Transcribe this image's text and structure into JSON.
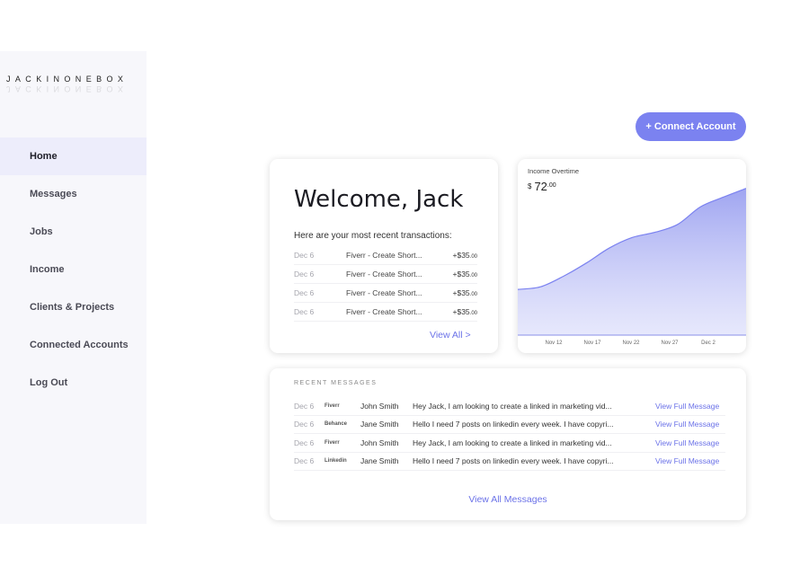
{
  "brand": "JACKINONEBOX",
  "nav": [
    {
      "label": "Home",
      "active": true
    },
    {
      "label": "Messages",
      "active": false
    },
    {
      "label": "Jobs",
      "active": false
    },
    {
      "label": "Income",
      "active": false
    },
    {
      "label": "Clients & Projects",
      "active": false
    },
    {
      "label": "Connected Accounts",
      "active": false
    },
    {
      "label": "Log Out",
      "active": false
    }
  ],
  "connect_button": "+ Connect Account",
  "welcome": {
    "title": "Welcome, Jack",
    "subtitle": "Here are your most recent transactions:",
    "transactions": [
      {
        "date": "Dec 6",
        "desc": "Fiverr - Create Short...",
        "amount": "+$35",
        "cents": ".00"
      },
      {
        "date": "Dec 6",
        "desc": "Fiverr - Create Short...",
        "amount": "+$35",
        "cents": ".00"
      },
      {
        "date": "Dec 6",
        "desc": "Fiverr - Create Short...",
        "amount": "+$35",
        "cents": ".00"
      },
      {
        "date": "Dec 6",
        "desc": "Fiverr - Create Short...",
        "amount": "+$35",
        "cents": ".00"
      }
    ],
    "view_all": "View All >"
  },
  "income": {
    "label": "Income Overtime",
    "currency": "$",
    "amount": "72",
    "cents": ".00"
  },
  "chart_data": {
    "type": "area",
    "x": [
      "Nov 12",
      "Nov 17",
      "Nov 22",
      "Nov 27",
      "Dec 2"
    ],
    "tick_labels": [
      "Nov 12",
      "Nov 17",
      "Nov 22",
      "Nov 27",
      "Dec 2"
    ],
    "values": [
      52,
      55,
      67,
      82,
      99,
      111,
      117,
      126,
      146,
      157,
      167
    ],
    "ylim": [
      0,
      180
    ],
    "grid": false,
    "fill_color": "#a4a8f2",
    "line_color": "#7b82f0"
  },
  "messages": {
    "header": "RECENT MESSAGES",
    "items": [
      {
        "date": "Dec 6",
        "source": "Fiverr",
        "name": "John Smith",
        "text": "Hey Jack, I am looking to create a linked in marketing vid...",
        "link": "View Full Message"
      },
      {
        "date": "Dec 6",
        "source": "Behance",
        "name": "Jane Smith",
        "text": "Hello I need 7 posts on linkedin every week. I have copyri...",
        "link": "View Full Message"
      },
      {
        "date": "Dec 6",
        "source": "Fiverr",
        "name": "John Smith",
        "text": "Hey Jack, I am looking to create a linked in marketing vid...",
        "link": "View Full Message"
      },
      {
        "date": "Dec 6",
        "source": "Linkedin",
        "name": "Jane Smith",
        "text": "Hello I need 7 posts on linkedin every week. I have copyri...",
        "link": "View Full Message"
      }
    ],
    "view_all": "View All Messages"
  }
}
